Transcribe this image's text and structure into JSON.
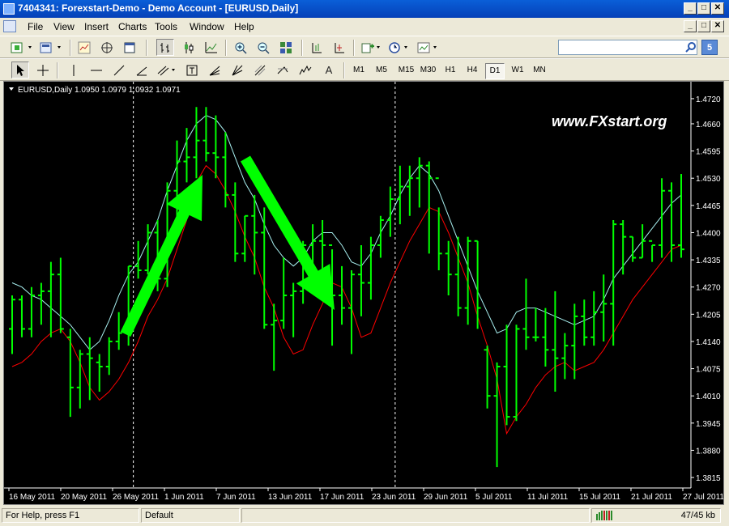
{
  "window": {
    "title": "7404341: Forexstart-Demo - Demo Account - [EURUSD,Daily]"
  },
  "menu": [
    "File",
    "View",
    "Insert",
    "Charts",
    "Tools",
    "Window",
    "Help"
  ],
  "window_buttons": {
    "minimize": "_",
    "restore": "□",
    "close": "✕"
  },
  "toolbar": {
    "label_tool": "A",
    "search_placeholder": "",
    "search_badge": "5"
  },
  "timeframes": [
    {
      "label": "M1",
      "active": false
    },
    {
      "label": "M5",
      "active": false
    },
    {
      "label": "M15",
      "active": false
    },
    {
      "label": "M30",
      "active": false
    },
    {
      "label": "H1",
      "active": false
    },
    {
      "label": "H4",
      "active": false
    },
    {
      "label": "D1",
      "active": true
    },
    {
      "label": "W1",
      "active": false
    },
    {
      "label": "MN",
      "active": false
    }
  ],
  "chart": {
    "symbol_label": "EURUSD,Daily  1.0950 1.0979 1.0932 1.0971",
    "watermark": "www.FXstart.org",
    "colors": {
      "background": "#000000",
      "bars": "#00ff00",
      "ma_fast": "#a8f0f0",
      "ma_slow": "#ff0000",
      "arrows": "#00ff00",
      "axis_text": "#ffffff"
    }
  },
  "chart_data": {
    "type": "ohlc",
    "symbol": "EURUSD",
    "timeframe": "Daily",
    "y_ticks": [
      "1.4720",
      "1.4660",
      "1.4595",
      "1.4530",
      "1.4465",
      "1.4400",
      "1.4335",
      "1.4270",
      "1.4205",
      "1.4140",
      "1.4075",
      "1.4010",
      "1.3945",
      "1.3880",
      "1.3815"
    ],
    "x_ticks": [
      "16 May 2011",
      "20 May 2011",
      "26 May 2011",
      "1 Jun 2011",
      "7 Jun 2011",
      "13 Jun 2011",
      "17 Jun 2011",
      "23 Jun 2011",
      "29 Jun 2011",
      "5 Jul 2011",
      "11 Jul 2011",
      "15 Jul 2011",
      "21 Jul 2011",
      "27 Jul 2011"
    ],
    "period_separators": [
      "1 Jun 2011",
      "1 Jul 2011"
    ],
    "bars": [
      {
        "o": 1.417,
        "h": 1.425,
        "l": 1.411,
        "c": 1.424
      },
      {
        "o": 1.424,
        "h": 1.425,
        "l": 1.415,
        "c": 1.417
      },
      {
        "o": 1.417,
        "h": 1.427,
        "l": 1.415,
        "c": 1.425
      },
      {
        "o": 1.425,
        "h": 1.428,
        "l": 1.418,
        "c": 1.426
      },
      {
        "o": 1.426,
        "h": 1.433,
        "l": 1.415,
        "c": 1.43
      },
      {
        "o": 1.43,
        "h": 1.434,
        "l": 1.416,
        "c": 1.417
      },
      {
        "o": 1.415,
        "h": 1.417,
        "l": 1.396,
        "c": 1.403
      },
      {
        "o": 1.403,
        "h": 1.412,
        "l": 1.398,
        "c": 1.411
      },
      {
        "o": 1.411,
        "h": 1.415,
        "l": 1.4,
        "c": 1.41
      },
      {
        "o": 1.409,
        "h": 1.411,
        "l": 1.402,
        "c": 1.408
      },
      {
        "o": 1.408,
        "h": 1.415,
        "l": 1.406,
        "c": 1.414
      },
      {
        "o": 1.414,
        "h": 1.421,
        "l": 1.412,
        "c": 1.416
      },
      {
        "o": 1.416,
        "h": 1.432,
        "l": 1.413,
        "c": 1.432
      },
      {
        "o": 1.432,
        "h": 1.438,
        "l": 1.429,
        "c": 1.431
      },
      {
        "o": 1.431,
        "h": 1.442,
        "l": 1.43,
        "c": 1.44
      },
      {
        "o": 1.44,
        "h": 1.443,
        "l": 1.426,
        "c": 1.429
      },
      {
        "o": 1.429,
        "h": 1.452,
        "l": 1.427,
        "c": 1.45
      },
      {
        "o": 1.45,
        "h": 1.462,
        "l": 1.442,
        "c": 1.457
      },
      {
        "o": 1.457,
        "h": 1.465,
        "l": 1.452,
        "c": 1.458
      },
      {
        "o": 1.458,
        "h": 1.47,
        "l": 1.453,
        "c": 1.462
      },
      {
        "o": 1.462,
        "h": 1.47,
        "l": 1.457,
        "c": 1.459
      },
      {
        "o": 1.459,
        "h": 1.468,
        "l": 1.453,
        "c": 1.458
      },
      {
        "o": 1.458,
        "h": 1.464,
        "l": 1.446,
        "c": 1.449
      },
      {
        "o": 1.449,
        "h": 1.452,
        "l": 1.433,
        "c": 1.435
      },
      {
        "o": 1.435,
        "h": 1.444,
        "l": 1.433,
        "c": 1.444
      },
      {
        "o": 1.444,
        "h": 1.449,
        "l": 1.43,
        "c": 1.44
      },
      {
        "o": 1.44,
        "h": 1.446,
        "l": 1.417,
        "c": 1.418
      },
      {
        "o": 1.418,
        "h": 1.423,
        "l": 1.407,
        "c": 1.419
      },
      {
        "o": 1.419,
        "h": 1.434,
        "l": 1.417,
        "c": 1.425
      },
      {
        "o": 1.425,
        "h": 1.428,
        "l": 1.415,
        "c": 1.426
      },
      {
        "o": 1.426,
        "h": 1.438,
        "l": 1.423,
        "c": 1.437
      },
      {
        "o": 1.437,
        "h": 1.442,
        "l": 1.429,
        "c": 1.438
      },
      {
        "o": 1.438,
        "h": 1.443,
        "l": 1.427,
        "c": 1.437
      },
      {
        "o": 1.437,
        "h": 1.436,
        "l": 1.413,
        "c": 1.425
      },
      {
        "o": 1.425,
        "h": 1.432,
        "l": 1.418,
        "c": 1.422
      },
      {
        "o": 1.422,
        "h": 1.431,
        "l": 1.411,
        "c": 1.43
      },
      {
        "o": 1.43,
        "h": 1.437,
        "l": 1.42,
        "c": 1.428
      },
      {
        "o": 1.428,
        "h": 1.439,
        "l": 1.424,
        "c": 1.437
      },
      {
        "o": 1.437,
        "h": 1.444,
        "l": 1.434,
        "c": 1.443
      },
      {
        "o": 1.443,
        "h": 1.451,
        "l": 1.439,
        "c": 1.448
      },
      {
        "o": 1.448,
        "h": 1.456,
        "l": 1.442,
        "c": 1.451
      },
      {
        "o": 1.451,
        "h": 1.456,
        "l": 1.444,
        "c": 1.453
      },
      {
        "o": 1.453,
        "h": 1.458,
        "l": 1.446,
        "c": 1.456
      },
      {
        "o": 1.456,
        "h": 1.457,
        "l": 1.435,
        "c": 1.453
      },
      {
        "o": 1.453,
        "h": 1.446,
        "l": 1.431,
        "c": 1.435
      },
      {
        "o": 1.435,
        "h": 1.438,
        "l": 1.425,
        "c": 1.43
      },
      {
        "o": 1.43,
        "h": 1.439,
        "l": 1.42,
        "c": 1.422
      },
      {
        "o": 1.422,
        "h": 1.439,
        "l": 1.418,
        "c": 1.438
      },
      {
        "o": 1.438,
        "h": 1.438,
        "l": 1.417,
        "c": 1.422
      },
      {
        "o": 1.412,
        "h": 1.413,
        "l": 1.398,
        "c": 1.401
      },
      {
        "o": 1.401,
        "h": 1.409,
        "l": 1.384,
        "c": 1.408
      },
      {
        "o": 1.408,
        "h": 1.418,
        "l": 1.394,
        "c": 1.396
      },
      {
        "o": 1.396,
        "h": 1.418,
        "l": 1.395,
        "c": 1.417
      },
      {
        "o": 1.417,
        "h": 1.429,
        "l": 1.412,
        "c": 1.415
      },
      {
        "o": 1.415,
        "h": 1.422,
        "l": 1.414,
        "c": 1.415
      },
      {
        "o": 1.415,
        "h": 1.422,
        "l": 1.408,
        "c": 1.412
      },
      {
        "o": 1.412,
        "h": 1.426,
        "l": 1.402,
        "c": 1.41
      },
      {
        "o": 1.41,
        "h": 1.416,
        "l": 1.405,
        "c": 1.413
      },
      {
        "o": 1.413,
        "h": 1.423,
        "l": 1.405,
        "c": 1.42
      },
      {
        "o": 1.42,
        "h": 1.424,
        "l": 1.413,
        "c": 1.415
      },
      {
        "o": 1.415,
        "h": 1.426,
        "l": 1.413,
        "c": 1.421
      },
      {
        "o": 1.421,
        "h": 1.43,
        "l": 1.414,
        "c": 1.423
      },
      {
        "o": 1.423,
        "h": 1.443,
        "l": 1.413,
        "c": 1.442
      },
      {
        "o": 1.442,
        "h": 1.443,
        "l": 1.43,
        "c": 1.439
      },
      {
        "o": 1.439,
        "h": 1.439,
        "l": 1.433,
        "c": 1.434
      },
      {
        "o": 1.434,
        "h": 1.442,
        "l": 1.434,
        "c": 1.438
      },
      {
        "o": 1.438,
        "h": 1.437,
        "l": 1.433,
        "c": 1.437
      },
      {
        "o": 1.437,
        "h": 1.453,
        "l": 1.434,
        "c": 1.45
      },
      {
        "o": 1.45,
        "h": 1.452,
        "l": 1.433,
        "c": 1.437
      },
      {
        "o": 1.437,
        "h": 1.454,
        "l": 1.434,
        "c": 1.436
      }
    ],
    "ma_fast": [
      1.428,
      1.427,
      1.425,
      1.424,
      1.422,
      1.42,
      1.418,
      1.415,
      1.412,
      1.414,
      1.419,
      1.425,
      1.43,
      1.433,
      1.438,
      1.443,
      1.45,
      1.456,
      1.462,
      1.466,
      1.468,
      1.467,
      1.464,
      1.458,
      1.452,
      1.448,
      1.442,
      1.437,
      1.434,
      1.432,
      1.434,
      1.438,
      1.44,
      1.44,
      1.437,
      1.433,
      1.432,
      1.435,
      1.44,
      1.444,
      1.449,
      1.453,
      1.456,
      1.454,
      1.45,
      1.444,
      1.438,
      1.432,
      1.426,
      1.421,
      1.416,
      1.417,
      1.421,
      1.422,
      1.422,
      1.421,
      1.42,
      1.419,
      1.418,
      1.419,
      1.42,
      1.424,
      1.429,
      1.432,
      1.435,
      1.438,
      1.441,
      1.444,
      1.447,
      1.449
    ],
    "ma_slow": [
      1.408,
      1.409,
      1.411,
      1.414,
      1.416,
      1.417,
      1.414,
      1.409,
      1.403,
      1.4,
      1.402,
      1.405,
      1.409,
      1.414,
      1.42,
      1.424,
      1.429,
      1.436,
      1.443,
      1.452,
      1.456,
      1.454,
      1.45,
      1.445,
      1.439,
      1.434,
      1.427,
      1.422,
      1.415,
      1.411,
      1.412,
      1.418,
      1.423,
      1.428,
      1.427,
      1.422,
      1.415,
      1.416,
      1.422,
      1.428,
      1.433,
      1.438,
      1.442,
      1.446,
      1.445,
      1.44,
      1.434,
      1.428,
      1.42,
      1.413,
      1.405,
      1.392,
      1.396,
      1.399,
      1.403,
      1.406,
      1.408,
      1.409,
      1.407,
      1.408,
      1.409,
      1.412,
      1.416,
      1.42,
      1.424,
      1.427,
      1.43,
      1.433,
      1.436,
      1.437
    ],
    "ylim": [
      1.379,
      1.4745
    ]
  },
  "status": {
    "help": "For Help, press F1",
    "profile": "Default",
    "traffic": "47/45 kb"
  }
}
